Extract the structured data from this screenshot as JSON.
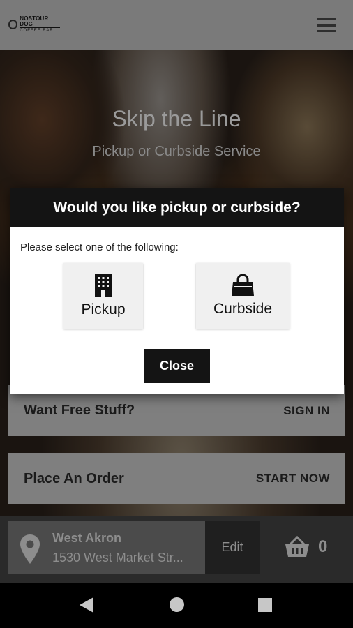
{
  "header": {
    "logo_line1": "NOSTOUR DOG",
    "logo_line2": "COFFEE BAR",
    "menu_icon": "hamburger-menu-icon"
  },
  "hero": {
    "title": "Skip the Line",
    "subtitle": "Pickup or Curbside Service"
  },
  "cards": {
    "free_stuff": {
      "title": "Want Free Stuff?",
      "action": "SIGN IN"
    },
    "place_order": {
      "title": "Place An Order",
      "action": "START NOW"
    }
  },
  "location": {
    "name": "West Akron",
    "address": "1530 West Market Str...",
    "edit_label": "Edit",
    "pin_icon": "location-pin-icon"
  },
  "cart": {
    "icon": "shopping-basket-icon",
    "count": "0"
  },
  "dialog": {
    "title": "Would you like pickup or curbside?",
    "prompt": "Please select one of the following:",
    "options": [
      {
        "label": "Pickup",
        "icon": "building-icon"
      },
      {
        "label": "Curbside",
        "icon": "shopping-bag-icon"
      }
    ],
    "close_label": "Close"
  },
  "navbar": {
    "back_icon": "back-triangle-icon",
    "home_icon": "home-circle-icon",
    "recents_icon": "recents-square-icon"
  },
  "colors": {
    "dialog_header": "#141414",
    "overlay_card": "#7f7f7f",
    "accent_text": "#1b1b1b"
  }
}
